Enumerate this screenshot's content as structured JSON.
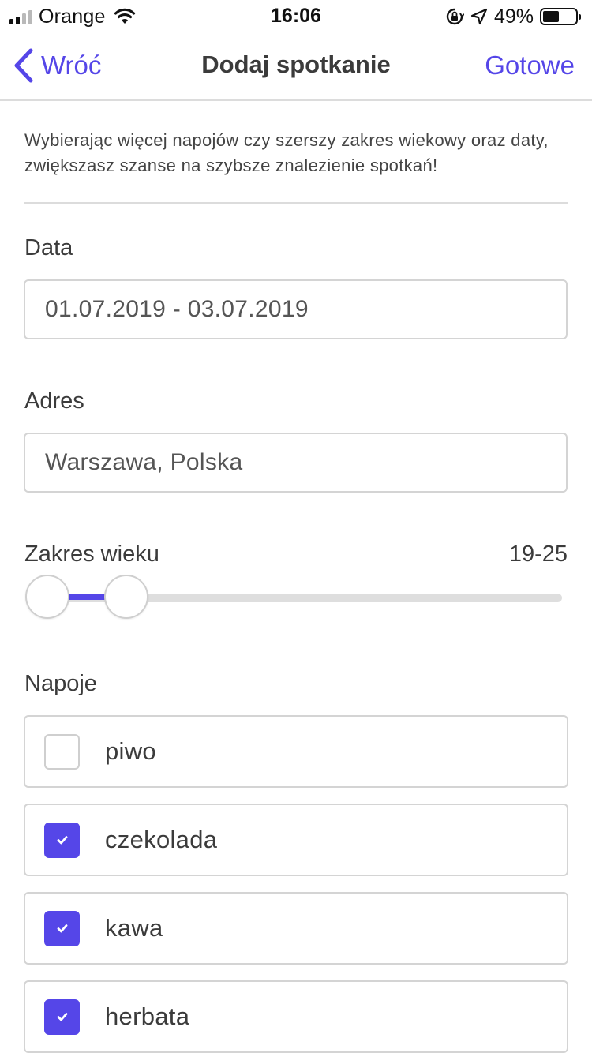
{
  "status_bar": {
    "carrier": "Orange",
    "time": "16:06",
    "battery_percent": "49%",
    "battery_level": 0.49,
    "signal_bars": 4,
    "signal_bars_filled": 2
  },
  "nav": {
    "back_label": "Wróć",
    "title": "Dodaj spotkanie",
    "done_label": "Gotowe"
  },
  "info_text": "Wybierając więcej napojów czy szerszy zakres wiekowy oraz daty, zwiększasz szanse na szybsze znalezienie spotkań!",
  "date": {
    "label": "Data",
    "value": "01.07.2019 - 03.07.2019"
  },
  "address": {
    "label": "Adres",
    "value": "Warszawa, Polska"
  },
  "age_range": {
    "label": "Zakres wieku",
    "value": "19-25",
    "slider_low": 0.0,
    "slider_high": 0.16
  },
  "drinks": {
    "label": "Napoje",
    "items": [
      {
        "label": "piwo",
        "checked": false
      },
      {
        "label": "czekolada",
        "checked": true
      },
      {
        "label": "kawa",
        "checked": true
      },
      {
        "label": "herbata",
        "checked": true
      }
    ]
  },
  "colors": {
    "accent": "#5546e8",
    "text": "#3b3b3b",
    "border": "#d4d4d4"
  }
}
